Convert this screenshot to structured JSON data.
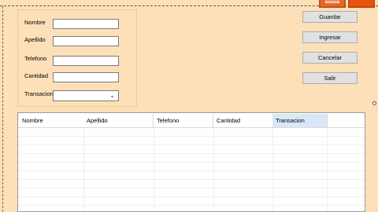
{
  "form": {
    "fields": [
      {
        "label": "Nombre",
        "value": ""
      },
      {
        "label": "Apellido",
        "value": ""
      },
      {
        "label": "Telefono",
        "value": ""
      },
      {
        "label": "Cantidad",
        "value": ""
      }
    ],
    "transaction": {
      "label": "Transacion",
      "selected": ""
    }
  },
  "buttons": {
    "save": "Guardar",
    "enter": "Ingresar",
    "cancel": "Cancelar",
    "exit": "Salir"
  },
  "grid": {
    "columns": [
      "Nombre",
      "Apellido",
      "Telefono",
      "Cantidad",
      "Transacion"
    ],
    "selected_column": "Transacion",
    "rows": []
  },
  "icons": {
    "window_button_1": "restore-icon",
    "window_button_2": "close-icon",
    "combo_arrow": "chevron-down-icon"
  },
  "colors": {
    "background": "#fde0b8",
    "window_button": "#e36a2a",
    "header_selected": "#d9e8f6"
  }
}
